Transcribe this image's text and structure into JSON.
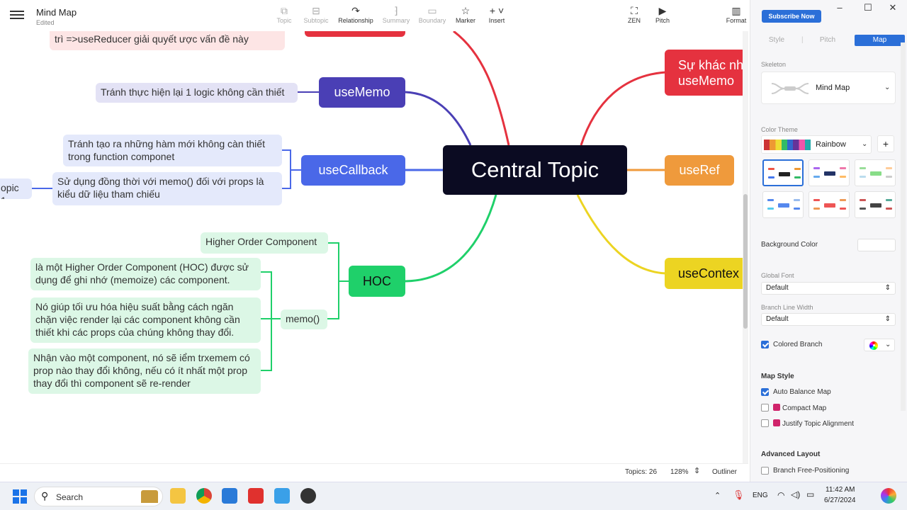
{
  "app": {
    "title": "Mind Map",
    "status": "Edited"
  },
  "toolbar": {
    "items": [
      {
        "label": "Topic",
        "icon": "topic-icon",
        "enabled": false
      },
      {
        "label": "Subtopic",
        "icon": "subtopic-icon",
        "enabled": false
      },
      {
        "label": "Relationship",
        "icon": "relationship-icon",
        "enabled": true
      },
      {
        "label": "Summary",
        "icon": "summary-icon",
        "enabled": false
      },
      {
        "label": "Boundary",
        "icon": "boundary-icon",
        "enabled": false
      },
      {
        "label": "Marker",
        "icon": "star-icon",
        "enabled": true
      },
      {
        "label": "Insert",
        "icon": "plus-icon",
        "enabled": true
      },
      {
        "label": "ZEN",
        "icon": "zen-icon",
        "enabled": true
      },
      {
        "label": "Pitch",
        "icon": "pitch-icon",
        "enabled": true
      },
      {
        "label": "Format",
        "icon": "format-icon",
        "enabled": true
      }
    ]
  },
  "map": {
    "central": "Central Topic",
    "top_note": "trì =>useReducer giải quyết ược vấn đề này",
    "use_memo": {
      "label": "useMemo",
      "child": "Tránh thực hiện lại 1 logic không cần thiết"
    },
    "use_callback": {
      "label": "useCallback",
      "children": [
        "Tránh tạo ra những hàm mới không càn thiết trong function componet",
        "Sử dụng đồng thời với memo() đối với props là kiểu dữ liệu tham chiếu"
      ],
      "far_child": "opic 1"
    },
    "hoc": {
      "label": "HOC",
      "children": [
        "Higher Order Component",
        "memo()"
      ],
      "memo_children": [
        "là một Higher Order Component (HOC) được sử dụng để ghi nhớ (memoize) các component.",
        "Nó giúp tối ưu hóa hiệu suất bằng cách ngăn chặn việc render lại các component không cần thiết khi các props của chúng không thay đổi.",
        "Nhận vào một component, nó sẽ iểm trxemem có prop nào thay đổi không, nếu có ít nhất một prop thay đổi thì component sẽ re-render"
      ]
    },
    "right": {
      "diff": "Sự khác nh\nuseMemo",
      "use_ref": "useRef",
      "use_context": "useContex"
    }
  },
  "status": {
    "topics": "Topics: 26",
    "zoom": "128%",
    "outliner": "Outliner"
  },
  "panel": {
    "subscribe": "Subscribe Now",
    "tabs": [
      "Style",
      "Pitch",
      "Map"
    ],
    "active_tab": "Map",
    "skeleton_label": "Skeleton",
    "skeleton_value": "Mind Map",
    "color_theme_label": "Color Theme",
    "color_theme_value": "Rainbow",
    "background_color_label": "Background Color",
    "global_font_label": "Global Font",
    "global_font_value": "Default",
    "branch_line_label": "Branch Line Width",
    "branch_line_value": "Default",
    "colored_branch": "Colored Branch",
    "map_style": "Map Style",
    "auto_balance": "Auto Balance Map",
    "compact_map": "Compact Map",
    "justify": "Justify Topic Alignment",
    "advanced_layout": "Advanced Layout",
    "branch_free": "Branch Free-Positioning"
  },
  "taskbar": {
    "search": "Search",
    "lang": "ENG",
    "time": "11:42 AM",
    "date": "6/27/2024"
  },
  "colors": {
    "red": "#e5323f",
    "navy": "#4a3fb5",
    "blue": "#4a68e8",
    "green": "#1fd06a",
    "orange": "#ef9a3c",
    "yellow": "#ecd422"
  }
}
